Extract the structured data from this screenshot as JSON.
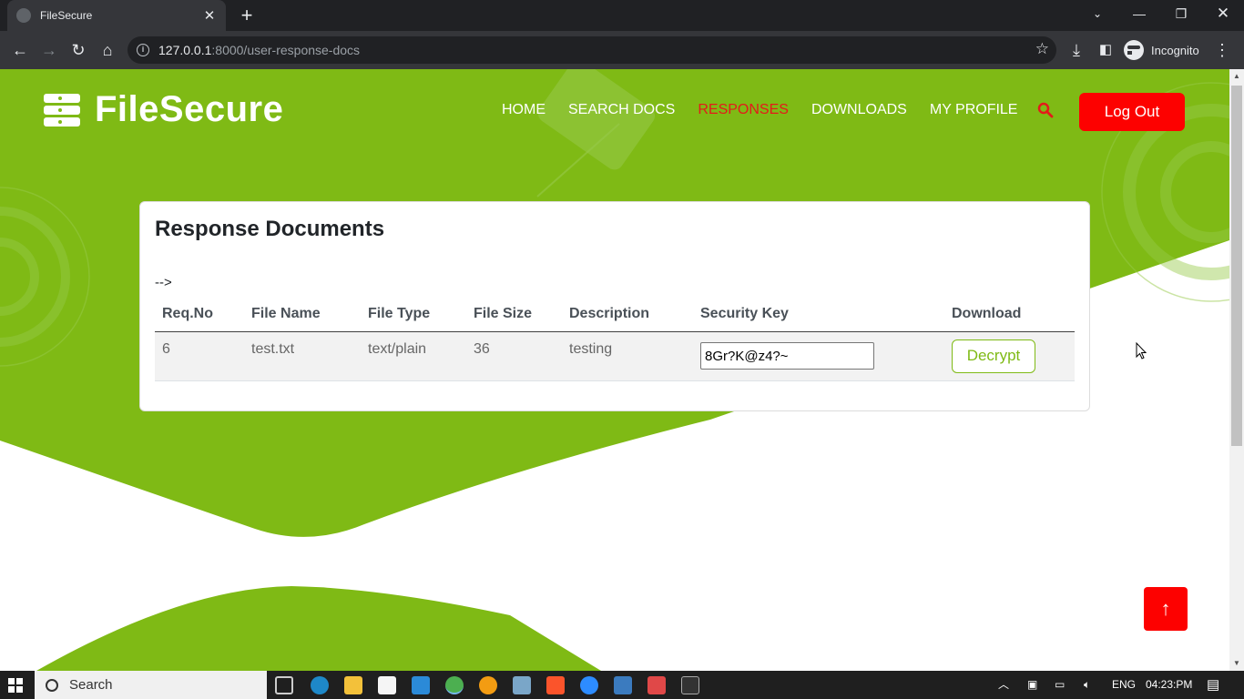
{
  "browser": {
    "tab_title": "FileSecure",
    "url_host": "127.0.0.1",
    "url_rest": ":8000/user-response-docs",
    "profile_label": "Incognito"
  },
  "site": {
    "brand": "FileSecure",
    "nav": [
      {
        "label": "HOME",
        "active": false
      },
      {
        "label": "SEARCH DOCS",
        "active": false
      },
      {
        "label": "RESPONSES",
        "active": true
      },
      {
        "label": "DOWNLOADS",
        "active": false
      },
      {
        "label": "MY PROFILE",
        "active": false
      }
    ],
    "logout_label": "Log Out",
    "accent": "#7fba15",
    "danger": "#fd0100"
  },
  "card": {
    "title": "Response Documents",
    "stray_text": "-->",
    "columns": [
      "Req.No",
      "File Name",
      "File Type",
      "File Size",
      "Description",
      "Security Key",
      "Download"
    ],
    "rows": [
      {
        "req_no": "6",
        "file_name": "test.txt",
        "file_type": "text/plain",
        "file_size": "36",
        "description": "testing",
        "security_key": "8Gr?K@z4?~",
        "action_label": "Decrypt"
      }
    ]
  },
  "taskbar": {
    "search_label": "Search",
    "language": "ENG",
    "time": "04:23:PM"
  }
}
